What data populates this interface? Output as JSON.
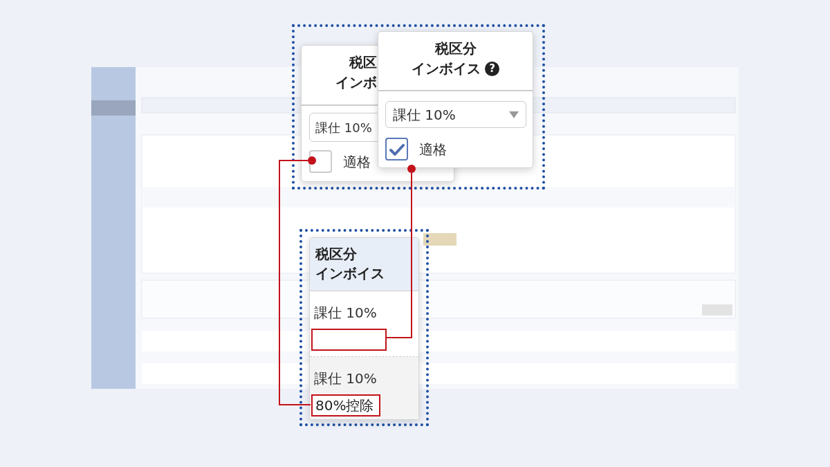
{
  "popups": [
    {
      "title_lines": [
        "税区",
        "インボ"
      ],
      "select": "課仕 10%",
      "checkbox": {
        "label": "適格",
        "checked": false
      }
    },
    {
      "title_lines": [
        "税区分",
        "インボイス"
      ],
      "help_mark": "?",
      "select": "課仕 10%",
      "checkbox": {
        "label": "適格",
        "checked": true
      }
    }
  ],
  "table_column": {
    "title_lines": [
      "税区分",
      "インボイス"
    ],
    "rows": [
      {
        "tax": "課仕 10%"
      },
      {
        "tax": "課仕 10%",
        "invoice": "80%控除"
      }
    ]
  }
}
